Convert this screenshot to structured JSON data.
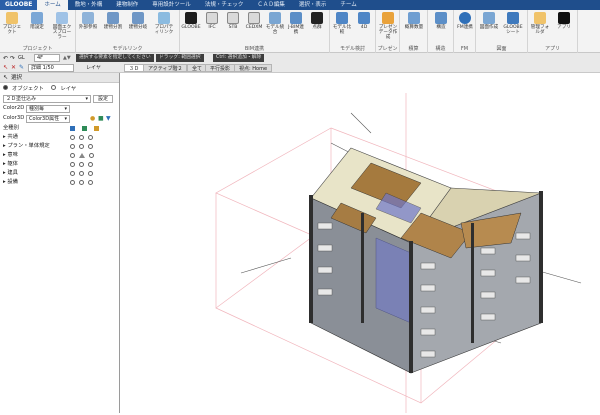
{
  "menu": {
    "app": "GLOOBE",
    "tabs": [
      "ホーム",
      "敷地・外構",
      "建物制作",
      "専用設計ツール",
      "法規・チェック",
      "ＣＡＤ編集",
      "選択・表示",
      "チーム"
    ]
  },
  "ribbon": {
    "groups": [
      {
        "label": "プロジェクト",
        "buttons": [
          "プロジェクト",
          "階設定",
          "図面エクスプローラー"
        ]
      },
      {
        "label": "モデルリンク",
        "buttons": [
          "外部参照",
          "建物分割",
          "建物分岐",
          "プロパティリンク"
        ]
      },
      {
        "label": "BIM連携",
        "buttons": [
          "GLOOBE",
          "IFC",
          "STB",
          "CEDXM",
          "モデル統合",
          "J-BIM連携",
          "点群"
        ]
      },
      {
        "label": "モデル検討",
        "buttons": [
          "モデル比較",
          "4D"
        ]
      },
      {
        "label": "プレゼン",
        "buttons": [
          "プレゼンデータ作成"
        ]
      },
      {
        "label": "積算",
        "buttons": [
          "概算数量"
        ]
      },
      {
        "label": "構造",
        "buttons": [
          "構造"
        ]
      },
      {
        "label": "FM",
        "buttons": [
          "FM連携"
        ]
      },
      {
        "label": "図面",
        "buttons": [
          "図面作成",
          "GLOOBEシート"
        ]
      },
      {
        "label": "アプリ",
        "buttons": [
          "管理フォルダ",
          "アプリ"
        ]
      }
    ]
  },
  "toolstrip": {
    "floor": "GL",
    "floor_value": "4F",
    "scale": "詳細 1/50",
    "layer": "レイヤ",
    "hints": [
      "選択する要素を指定してください",
      "ドラッグ: 範囲選択",
      "Ctrl: 選択追加・解除"
    ],
    "view_tabs": [
      "３Ｄ",
      "アクティブ階２",
      "全て",
      "平行投影",
      "視点: Home"
    ]
  },
  "panel": {
    "title": "選択",
    "radio_object": "オブジェクト",
    "radio_layer": "レイヤ",
    "mode": "２Ｄ塗仕込み",
    "set_button": "設定",
    "color2d_label": "Color2D",
    "color2d_value": "種別毎",
    "color3d_label": "Color3D",
    "color3d_value": "Color3D属性",
    "tree_header": "全種別",
    "tree_items": [
      "共通",
      "プラン・単体規定",
      "意味",
      "躯体",
      "建具",
      "設備"
    ]
  },
  "colors": {
    "menubar": "#1f4e8c",
    "ribbon_bg": "#f3f3f3",
    "accent_icon": "#2f6fb8"
  }
}
